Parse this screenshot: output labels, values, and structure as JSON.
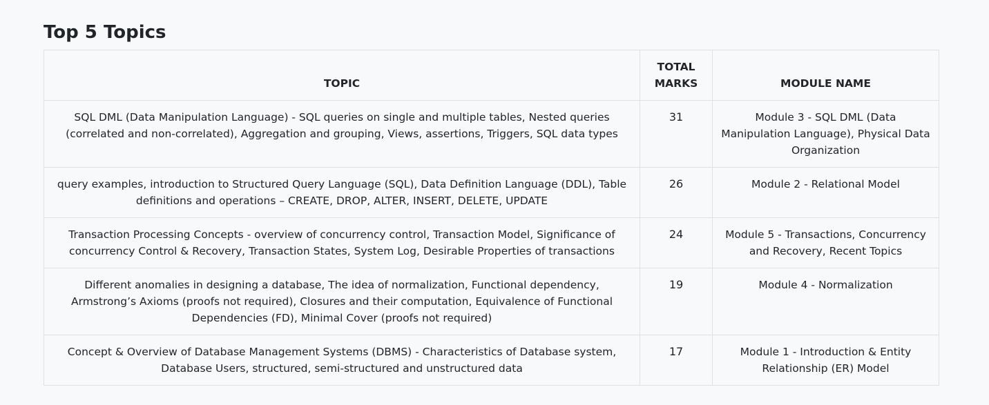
{
  "page": {
    "title": "Top 5 Topics"
  },
  "table": {
    "headers": {
      "topic": "TOPIC",
      "marks_line1": "TOTAL",
      "marks_line2": "MARKS",
      "module": "MODULE NAME"
    },
    "rows": [
      {
        "topic": "SQL DML (Data Manipulation Language) - SQL queries on single and multiple tables, Nested queries (correlated and non-correlated), Aggregation and grouping, Views, assertions, Triggers, SQL data types",
        "marks": "31",
        "module": "Module 3 - SQL DML (Data Manipulation Language), Physical Data Organization"
      },
      {
        "topic": "query examples, introduction to Structured Query Language (SQL), Data Definition Language (DDL), Table definitions and operations – CREATE, DROP, ALTER, INSERT, DELETE, UPDATE",
        "marks": "26",
        "module": "Module 2 - Relational Model"
      },
      {
        "topic": "Transaction Processing Concepts - overview of concurrency control, Transaction Model, Significance of concurrency Control & Recovery, Transaction States, System Log, Desirable Properties of transactions",
        "marks": "24",
        "module": "Module 5 - Transactions, Concurrency and Recovery, Recent Topics"
      },
      {
        "topic": "Different anomalies in designing a database, The idea of normalization, Functional dependency, Armstrong’s Axioms (proofs not required), Closures and their computation, Equivalence of Functional Dependencies (FD), Minimal Cover (proofs not required)",
        "marks": "19",
        "module": "Module 4 - Normalization"
      },
      {
        "topic": "Concept & Overview of Database Management Systems (DBMS) - Characteristics of Database system, Database Users, structured, semi-structured and unstructured data",
        "marks": "17",
        "module": "Module 1 - Introduction & Entity Relationship (ER) Model"
      }
    ]
  }
}
